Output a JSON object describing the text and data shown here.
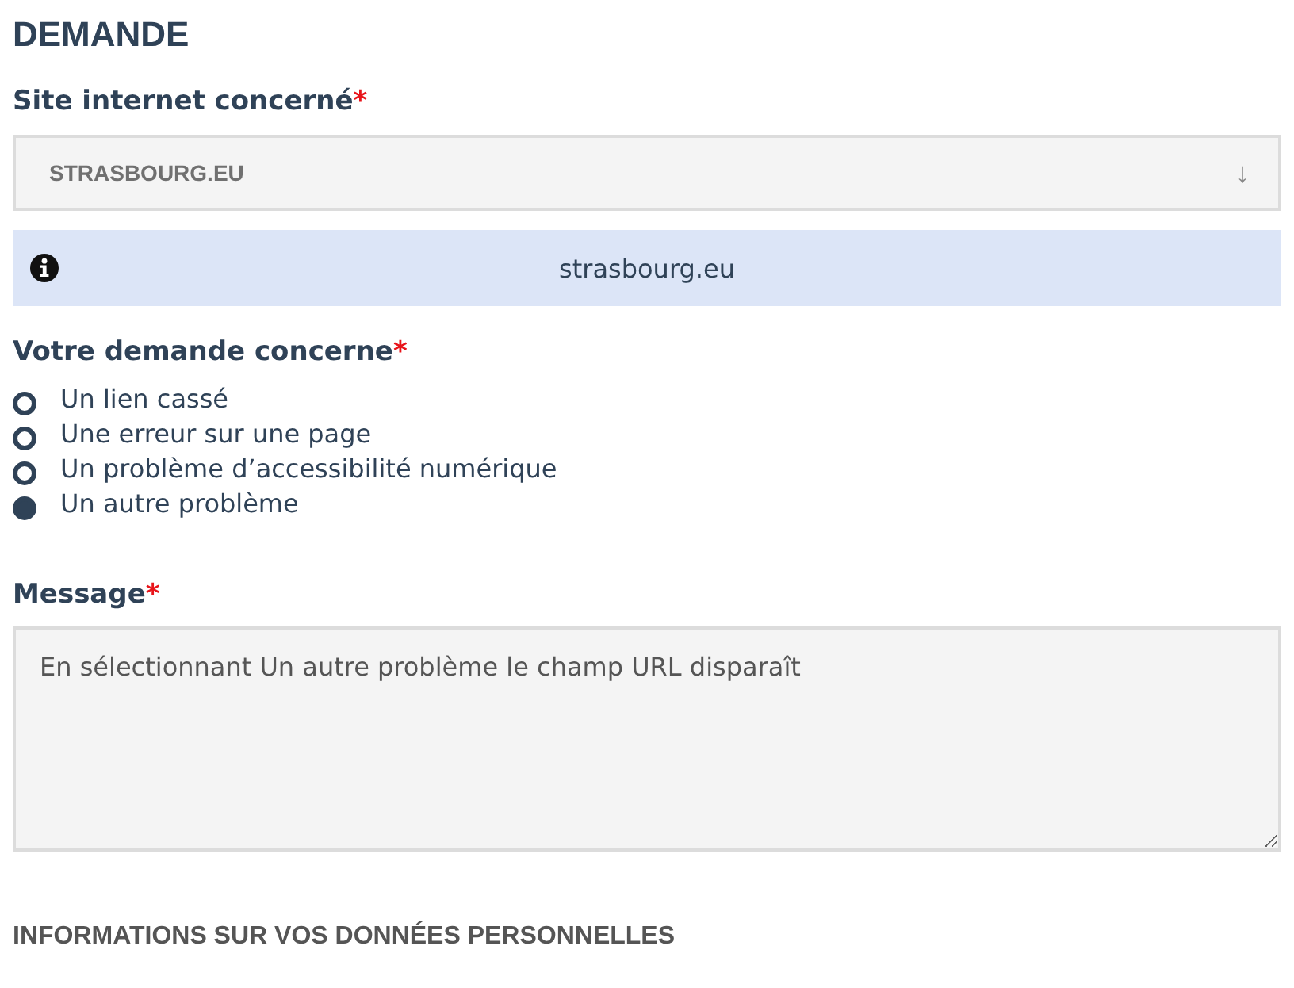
{
  "heading": "DEMANDE",
  "site_field": {
    "label": "Site internet concerné",
    "required_mark": "*",
    "value": "STRASBOURG.EU",
    "arrow": "↓"
  },
  "info": {
    "text": "strasbourg.eu"
  },
  "request_field": {
    "label": "Votre demande concerne",
    "required_mark": "*",
    "options": [
      {
        "label": "Un lien cassé",
        "selected": false
      },
      {
        "label": "Une erreur sur une page",
        "selected": false
      },
      {
        "label": "Un problème d’accessibilité numérique",
        "selected": false
      },
      {
        "label": "Un autre problème",
        "selected": true
      }
    ]
  },
  "message_field": {
    "label": "Message",
    "required_mark": "*",
    "value": "En sélectionnant Un autre problème le champ URL disparaît"
  },
  "section_heading": "INFORMATIONS SUR VOS DONNÉES PERSONNELLES"
}
